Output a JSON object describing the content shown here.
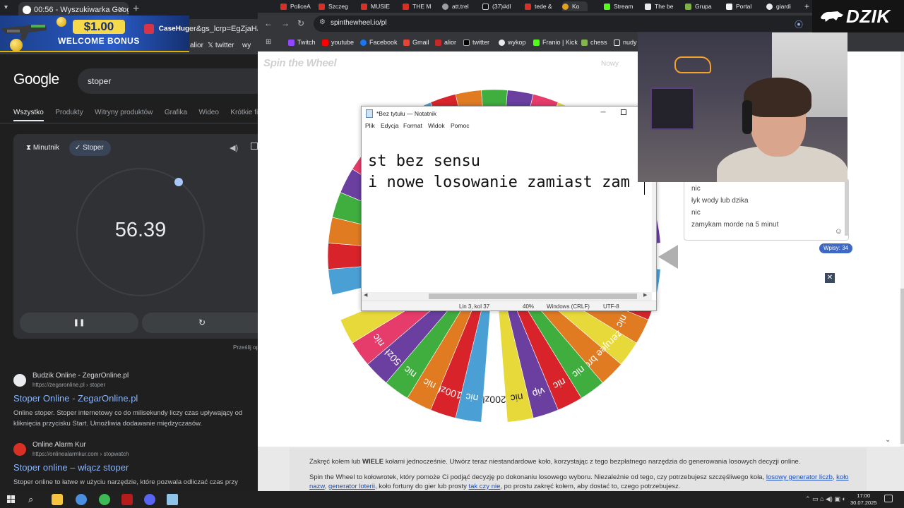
{
  "left_browser": {
    "tab_title": "00:56 - Wyszukiwarka Google",
    "new_tab_label": "+",
    "url_fragment": "er&gs_lcrp=EgZjaHJvb",
    "bookmarks": [
      "alior",
      "twitter",
      "wy"
    ],
    "banner": {
      "amount": "$1.00",
      "text": "WELCOME BONUS",
      "brand": "CaseHug"
    }
  },
  "google": {
    "logo": "Google",
    "query": "stoper",
    "tabs": [
      "Wszystko",
      "Produkty",
      "Witryny produktów",
      "Grafika",
      "Wideo",
      "Krótkie filmy"
    ],
    "stopwatch": {
      "timer_tab": "Minutnik",
      "stopwatch_tab": "Stoper",
      "time": "56.39",
      "pause_label": "❚❚",
      "reset_label": "↻",
      "feedback": "Prześlij op"
    },
    "results": [
      {
        "site": "Budzik Online - ZegarOnline.pl",
        "url": "https://zegaronline.pl › stoper",
        "title": "Stoper Online - ZegarOnline.pl",
        "snippet": "Online stoper. Stoper internetowy co do milisekundy liczy czas upływający od kliknięcia przycisku Start. Umożliwia dodawanie międzyczasów."
      },
      {
        "site": "Online Alarm Kur",
        "url": "https://onlinealarmkur.com › stopwatch",
        "title": "Stoper online – włącz stoper",
        "snippet": "Stoper online to łatwe w użyciu narzędzie, które pozwala odliczać czas przy"
      }
    ]
  },
  "main_browser": {
    "tabs": [
      "PoliceA",
      "Szczeg",
      "MUSIE",
      "THE M",
      "att.trel",
      "(37)#dl",
      "tede &",
      "Ko",
      "Stream",
      "The be",
      "Grupa",
      "Portal",
      "giardi"
    ],
    "new_tab_label": "+",
    "url": "spinthewheel.io/pl",
    "bookmarks": [
      "Twitch",
      "youtube",
      "Facebook",
      "Gmail",
      "alior",
      "twitter",
      "wykop",
      "Franio | Kick",
      "chess",
      "nudy"
    ]
  },
  "spin_page": {
    "logo": "Spin the Wheel",
    "new_label": "Nowy",
    "entries": [
      "nic",
      "łyk wody lub dzika",
      "nic",
      "zamykam morde na 5 minut"
    ],
    "entries_count": "Wpisy: 34",
    "close_label": "✕",
    "info_line1_prefix": "Zakręć kołem lub",
    "info_line1_bold": "WIELE",
    "info_line1_rest": "kołami jednocześnie. Utwórz teraz niestandardowe koło, korzystając z tego bezpłatnego narzędzia do generowania losowych decyzji online.",
    "info_line2_text": "Spin the Wheel to kołowrotek, który pomoże Ci podjąć decyzję po dokonaniu losowego wyboru. Niezależnie od tego, czy potrzebujesz szczęśliwego koła,",
    "info_link1": "losowy generator liczb",
    "info_link2": "koło nazw",
    "info_link3": "generator loterii",
    "info_line2_mid": ", koło fortuny do gier lub prosty",
    "info_link4": "tak czy nie",
    "info_line2_end": ", po prostu zakręć kołem, aby dostać to, czego potrzebujesz."
  },
  "wheel": {
    "segment_labels": [
      "200zł",
      "nic",
      "100zł",
      "nic",
      "nic",
      "50zł",
      "nic",
      "",
      "",
      "",
      "",
      "",
      "",
      "",
      "",
      "",
      "",
      "",
      "",
      "",
      "",
      "",
      "",
      "nic",
      "",
      "nic",
      "nic",
      "",
      "nic",
      "nic",
      "10$ gun",
      "",
      "nic",
      "nic",
      "",
      "zerujee browara",
      "nic",
      "nic",
      "vip",
      "nic"
    ],
    "segment_colors": [
      "#ffffff",
      "#4aa0d5",
      "#d8232a",
      "#e07b22",
      "#3fae3f",
      "#6a3fa0",
      "#e53c6b",
      "#e8d93a",
      "#ffffff",
      "#4aa0d5",
      "#d8232a",
      "#e07b22",
      "#3fae3f",
      "#6a3fa0",
      "#e53c6b",
      "#e8d93a",
      "#ffffff",
      "#4aa0d5",
      "#d8232a",
      "#e07b22",
      "#3fae3f",
      "#6a3fa0",
      "#e53c6b",
      "#e8d93a",
      "#ffffff",
      "#4aa0d5",
      "#d8232a",
      "#e07b22",
      "#3fae3f",
      "#6a3fa0",
      "#ffffff",
      "#4aa0d5",
      "#d8232a",
      "#e07b22",
      "#e8d93a",
      "#e07b22",
      "#3fae3f",
      "#d8232a",
      "#6a3fa0",
      "#e8d93a"
    ]
  },
  "notepad": {
    "title": "*Bez tytułu — Notatnik",
    "menu": [
      "Plik",
      "Edycja",
      "Format",
      "Widok",
      "Pomoc"
    ],
    "line1": "st bez sensu",
    "line2": "i nowe losowanie zamiast zam",
    "status": {
      "position": "Lin 3, kol 37",
      "zoom": "40%",
      "line_endings": "Windows (CRLF)",
      "encoding": "UTF-8"
    }
  },
  "overlay": {
    "logo": "DZIK"
  },
  "taskbar": {
    "time": "17:00",
    "date": "30.07.2025"
  },
  "colors": {
    "google_bg": "#1f1f1f",
    "link_blue": "#8ab4f8",
    "accent_blue": "#3d68c4"
  }
}
